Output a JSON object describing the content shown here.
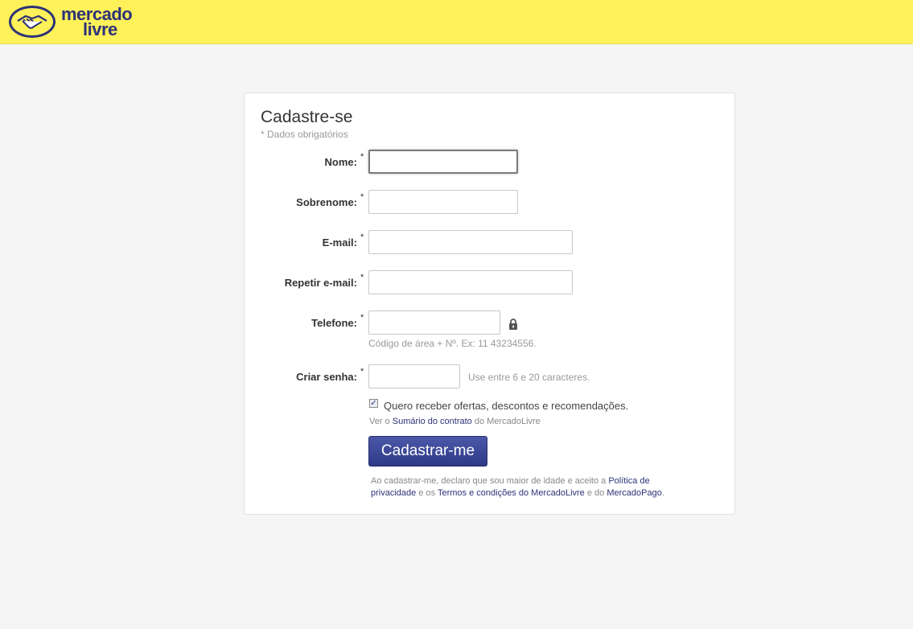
{
  "brand": {
    "logo_line1": "mercado",
    "logo_line2": "livre",
    "yellow": "#fff159",
    "navy": "#2d3277"
  },
  "form": {
    "title": "Cadastre-se",
    "required_note": "* Dados obrigatórios",
    "required_mark": "*",
    "fields": {
      "nome_label": "Nome:",
      "sobrenome_label": "Sobrenome:",
      "email_label": "E-mail:",
      "repeat_email_label": "Repetir e-mail:",
      "telefone_label": "Telefone:",
      "telefone_hint": "Código de área + Nº. Ex: 11 43234556.",
      "senha_label": "Criar senha:",
      "senha_hint": "Use entre 6 e 20 caracteres."
    },
    "offers_checkbox": {
      "checked": true,
      "label": "Quero receber ofertas, descontos e recomendações."
    },
    "contract": {
      "prefix": "Ver o ",
      "link": "Sumário do contrato",
      "suffix": " do MercadoLivre"
    },
    "submit_label": "Cadastrar-me",
    "legal": {
      "part1": "Ao cadastrar-me, declaro que sou maior de idade e aceito a ",
      "privacy_link": "Política de privacidade",
      "part2": " e os ",
      "terms_link": "Termos e condições do MercadoLivre",
      "part3": " e do ",
      "mp_link": "MercadoPago",
      "part4": "."
    }
  }
}
